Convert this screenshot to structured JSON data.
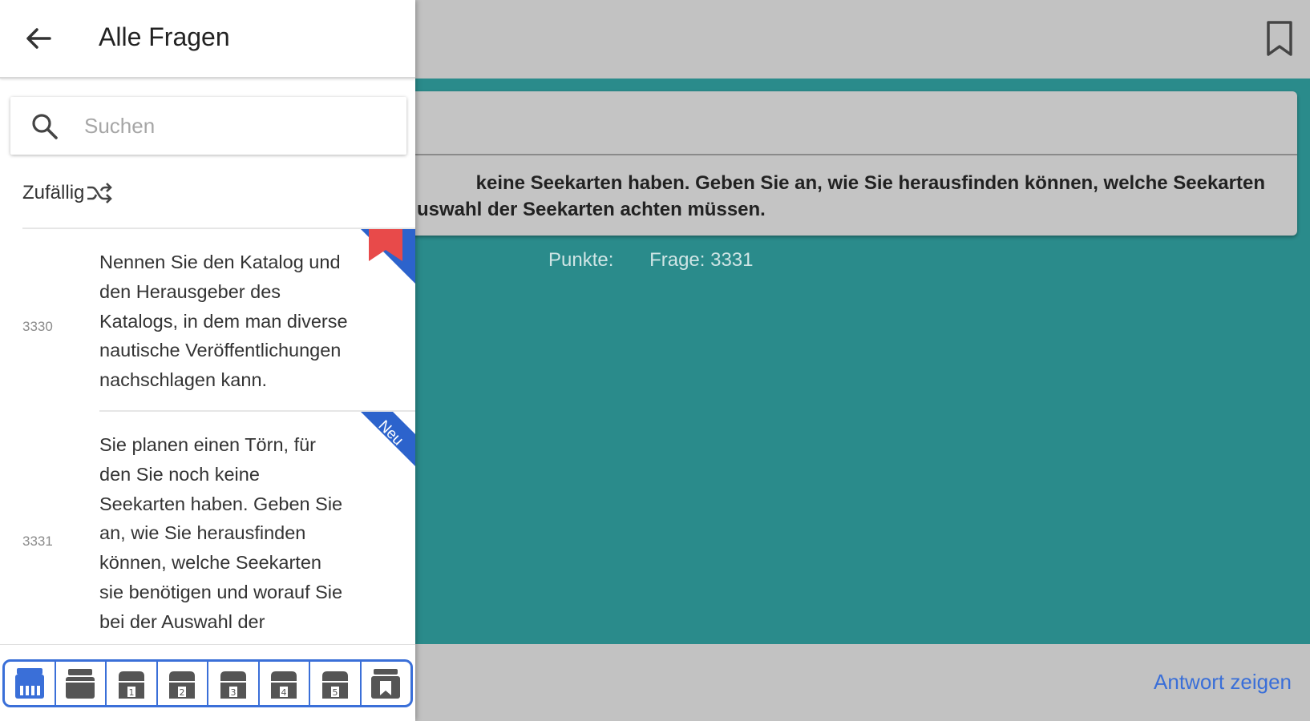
{
  "drawer": {
    "title": "Alle Fragen",
    "search_placeholder": "Suchen",
    "random_label": "Zufällig",
    "items": [
      {
        "number": "3330",
        "text": "Nennen Sie den Katalog und den Herausgeber des Katalogs, in dem man diverse nautische Veröffentlichungen nachschlagen kann."
      },
      {
        "number": "3331",
        "text": "Sie planen einen Törn, für den Sie noch keine Seekarten haben. Geben Sie an, wie Sie herausfinden können, welche Seekarten sie benötigen und worauf Sie bei der Auswahl der",
        "badge": "Neu"
      }
    ],
    "tabs": [
      {
        "icon": "all-boxes-icon"
      },
      {
        "icon": "box-icon"
      },
      {
        "icon": "box-1-icon",
        "label": "1"
      },
      {
        "icon": "box-2-icon",
        "label": "2"
      },
      {
        "icon": "box-3-icon",
        "label": "3"
      },
      {
        "icon": "box-4-icon",
        "label": "4"
      },
      {
        "icon": "box-5-icon",
        "label": "5"
      },
      {
        "icon": "bookmarked-box-icon"
      }
    ]
  },
  "main": {
    "question_line1": "keine Seekarten haben. Geben Sie an, wie Sie herausfinden können, welche Seekarten",
    "question_line2": "uswahl der Seekarten achten müssen.",
    "points_label": "Punkte:",
    "question_label": "Frage: 3331",
    "answer_button": "Antwort zeigen"
  },
  "colors": {
    "teal": "#2a8b8b",
    "accent_blue": "#3a6fd8",
    "ribbon_red": "#e84a4a",
    "ribbon_blue": "#2c63cc"
  }
}
